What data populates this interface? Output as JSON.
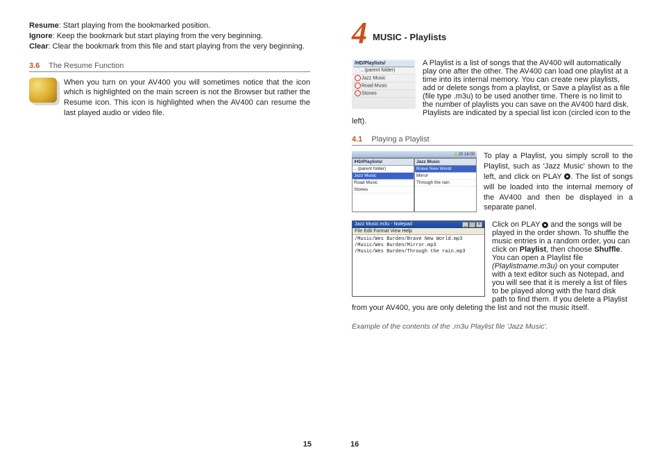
{
  "left": {
    "defs": {
      "resume_label": "Resume",
      "resume_text": ": Start playing from the bookmarked position.",
      "ignore_label": "Ignore",
      "ignore_text": ": Keep the bookmark but start playing from the very beginning.",
      "clear_label": "Clear",
      "clear_text": ": Clear the bookmark from this file and start playing from the very beginning."
    },
    "s36": {
      "num": "3.6",
      "title": "The Resume Function",
      "body": "When you turn on your AV400 you will sometimes notice that the icon which is highlighted on the main screen is not the Browser but rather the Resume icon. This icon is highlighted when the AV400 can resume the last played audio or video file."
    },
    "page_num": "15"
  },
  "right": {
    "chapter_num": "4",
    "chapter_title": "MUSIC - Playlists",
    "intro1": "A Playlist is a list of songs that the AV400 will automatically play one after the other. The AV400 can load one playlist at a time into its internal memory. You can create new playlists, add or delete songs from a playlist, or Save a playlist as a file (file type .m3u) to be used another time. There is no limit to the number of playlists you can save on the",
    "intro2": "AV400 hard disk. Playlists are indicated by a special list icon (circled icon to the left).",
    "playlist_panel": {
      "header": "/HD/Playlists/",
      "rows": [
        ".. (parent folder)",
        "Jazz Music",
        "Road Music",
        "Stones"
      ]
    },
    "s41": {
      "num": "4.1",
      "title": "Playing a Playlist"
    },
    "para_play_pre": "To play a Playlist, you simply scroll to the Playlist, such as 'Jazz Music' shown to the left, and click on PLAY ",
    "para_play_post": ". The list of songs will be loaded into the internal memory of the AV400 and then be displayed in a separate panel.",
    "browser": {
      "time": "20 16:00",
      "left_hdr": "/HD/Playlists/",
      "left_items": [
        ".. (parent folder)",
        "Jazz Music",
        "Road Music",
        "Stones"
      ],
      "right_hdr": "Jazz Music",
      "right_items": [
        "Brave New World",
        "Mirror",
        "Through the rain"
      ]
    },
    "para_shuffle_pre": "Click on PLAY ",
    "para_shuffle_mid1": " and the songs will be played in the order shown. To shuffle the music entries in a random order, you can click on ",
    "para_shuffle_bold1": "Playlist",
    "para_shuffle_mid2": ", then choose ",
    "para_shuffle_bold2": "Shuffle",
    "para_shuffle_mid3": ". You can open a Playlist file ",
    "para_shuffle_ital": "(Playlistname.m3u)",
    "para_shuffle_mid4": " on your computer with a text editor such",
    "para_shuffle_cont": "as Notepad, and you will see that it is merely a list of files to be played along with the hard disk path to find them. If you delete a Playlist from your AV400, you are only deleting the list and not the music itself.",
    "notepad": {
      "title": "Jazz Music.m3u - Notepad",
      "menu": "File   Edit   Format   View   Help",
      "lines": [
        "/Music/Wes Burden/Brave New World.mp3",
        "/Music/Wes Burden/Mirror.mp3",
        "/Music/Wes Burden/Through the rain.mp3"
      ]
    },
    "caption": "Example of the contents of the .m3u Playlist file 'Jazz Music'.",
    "page_num": "16"
  }
}
